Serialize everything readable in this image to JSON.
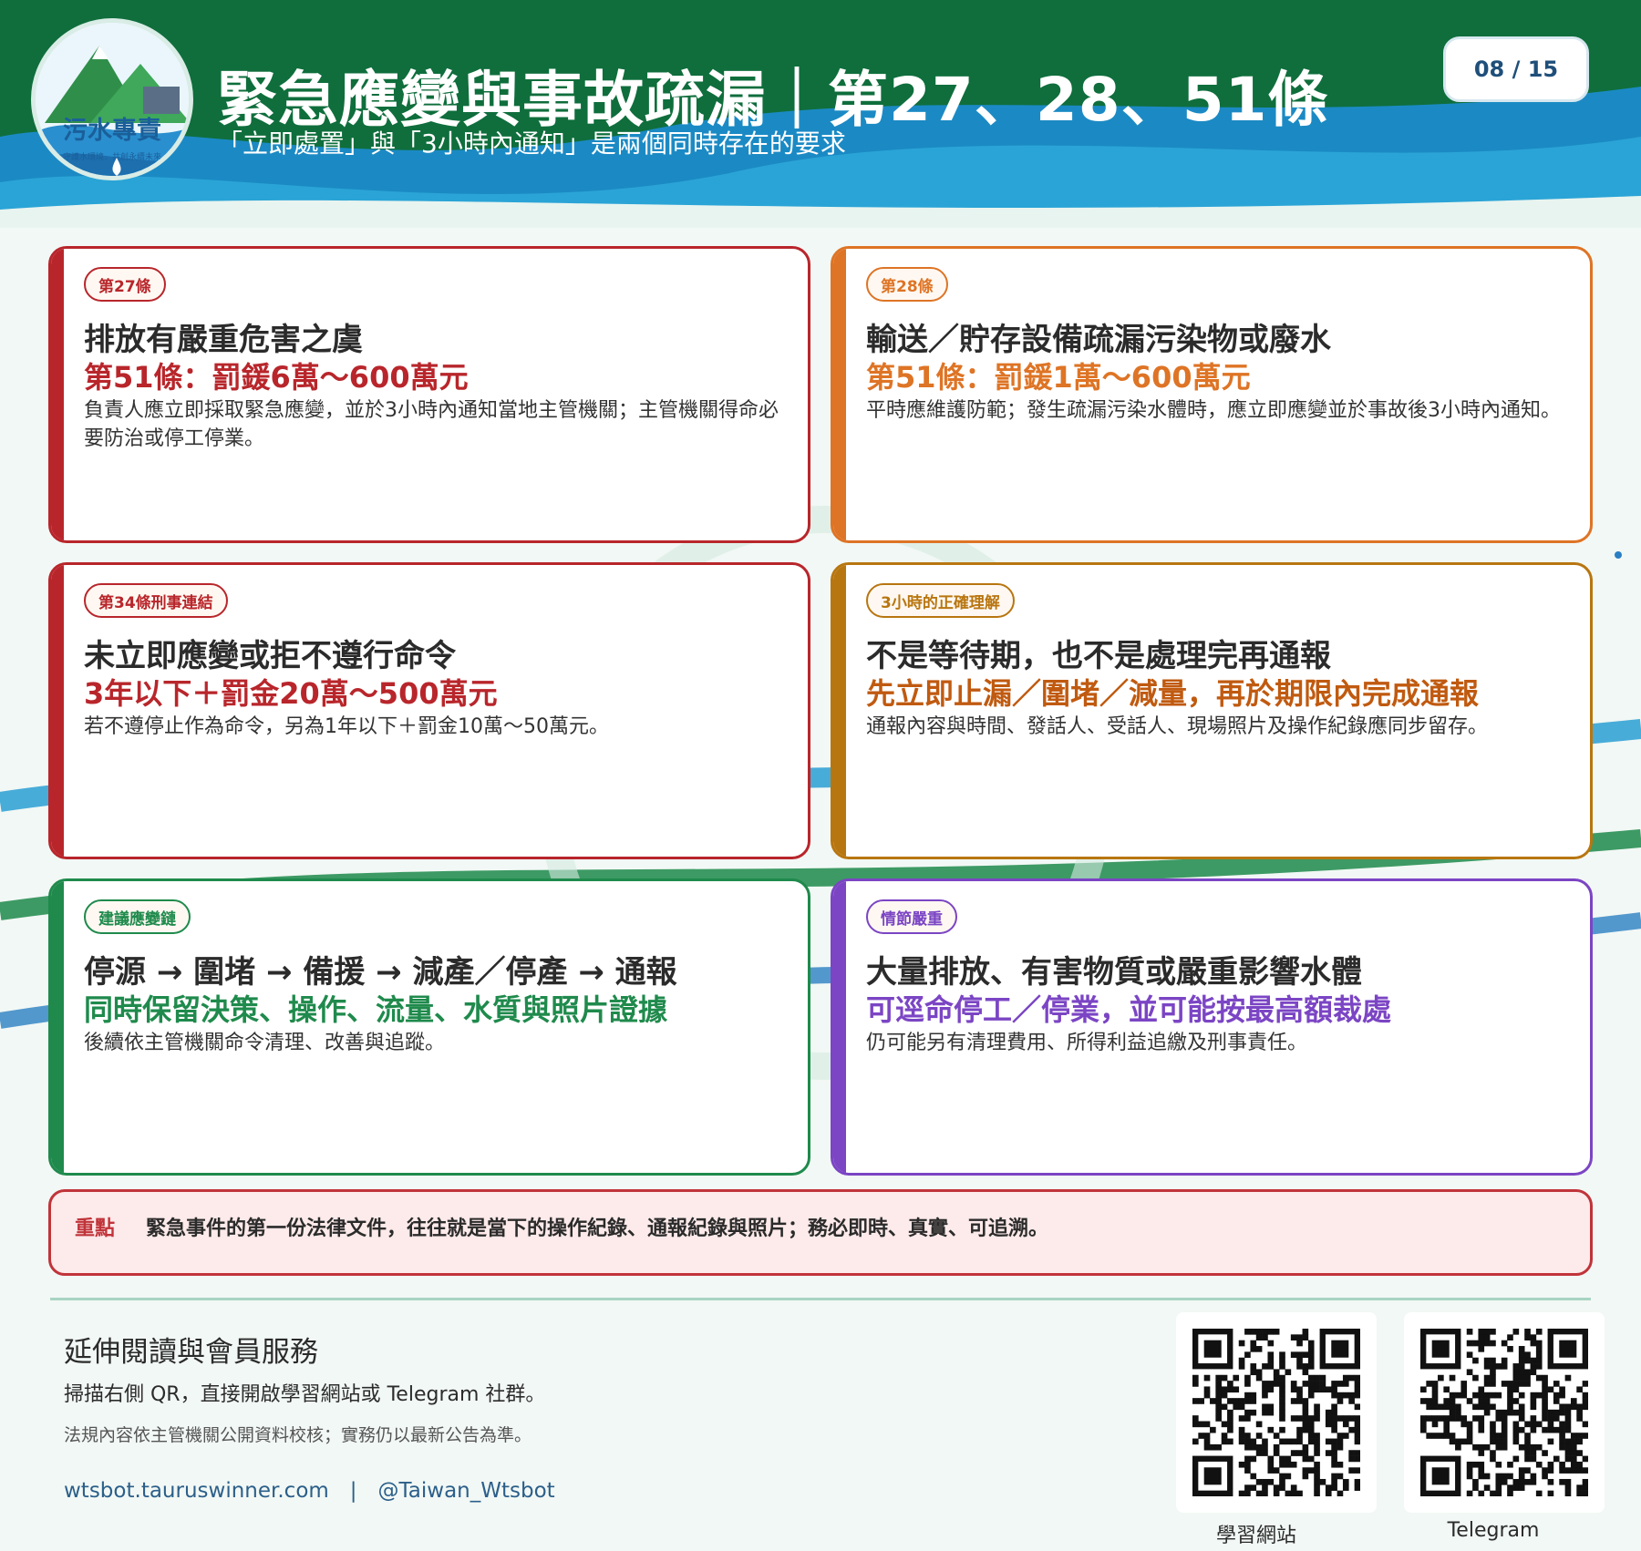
{
  "header": {
    "logo_text": "污水專責",
    "logo_tagline": "— 守護水環境．共創永續未來 —",
    "title": "緊急應變與事故疏漏｜第27、28、51條",
    "subtitle": "「立即處置」與「3小時內通知」是兩個同時存在的要求",
    "page_indicator": "08 / 15"
  },
  "cards": [
    {
      "tag": "第27條",
      "heading": "排放有嚴重危害之虞",
      "highlight": "第51條：罰鍰6萬～600萬元",
      "body": "負責人應立即採取緊急應變，並於3小時內通知當地主管機關；主管機關得命必要防治或停工停業。",
      "color": "#b8262b"
    },
    {
      "tag": "第28條",
      "heading": "輸送／貯存設備疏漏污染物或廢水",
      "highlight": "第51條：罰鍰1萬～600萬元",
      "body": "平時應維護防範；發生疏漏污染水體時，應立即應變並於事故後3小時內通知。",
      "color": "#de7425"
    },
    {
      "tag": "第34條刑事連結",
      "heading": "未立即應變或拒不遵行命令",
      "highlight": "3年以下＋罰金20萬～500萬元",
      "body": "若不遵停止作為命令，另為1年以下＋罰金10萬～50萬元。",
      "color": "#b8262b"
    },
    {
      "tag": "3小時的正確理解",
      "heading": "不是等待期，也不是處理完再通報",
      "highlight": "先立即止漏／圍堵／減量，再於期限內完成通報",
      "body": "通報內容與時間、發話人、受話人、現場照片及操作紀錄應同步留存。",
      "color": "#b87610",
      "highlight_color": "#c05a10"
    },
    {
      "tag": "建議應變鏈",
      "heading": "停源 → 圍堵 → 備援 → 減產／停產 → 通報",
      "highlight": "同時保留決策、操作、流量、水質與照片證據",
      "body": "後續依主管機關命令清理、改善與追蹤。",
      "color": "#1f8a4c"
    },
    {
      "tag": "情節嚴重",
      "heading": "大量排放、有害物質或嚴重影響水體",
      "highlight": "可逕命停工／停業，並可能按最高額裁處",
      "body": "仍可能另有清理費用、所得利益追繳及刑事責任。",
      "color": "#7b45c4"
    }
  ],
  "key_point": {
    "label": "重點",
    "text": "緊急事件的第一份法律文件，往往就是當下的操作紀錄、通報紀錄與照片；務必即時、真實、可追溯。"
  },
  "footer": {
    "title": "延伸閱讀與會員服務",
    "description": "掃描右側 QR，直接開啟學習網站或 Telegram 社群。",
    "note": "法規內容依主管機關公開資料校核；實務仍以最新公告為準。",
    "links": "wtsbot.tauruswinner.com　|　@Taiwan_Wtsbot",
    "qr_codes": [
      {
        "label": "學習網站"
      },
      {
        "label": "Telegram"
      }
    ]
  }
}
